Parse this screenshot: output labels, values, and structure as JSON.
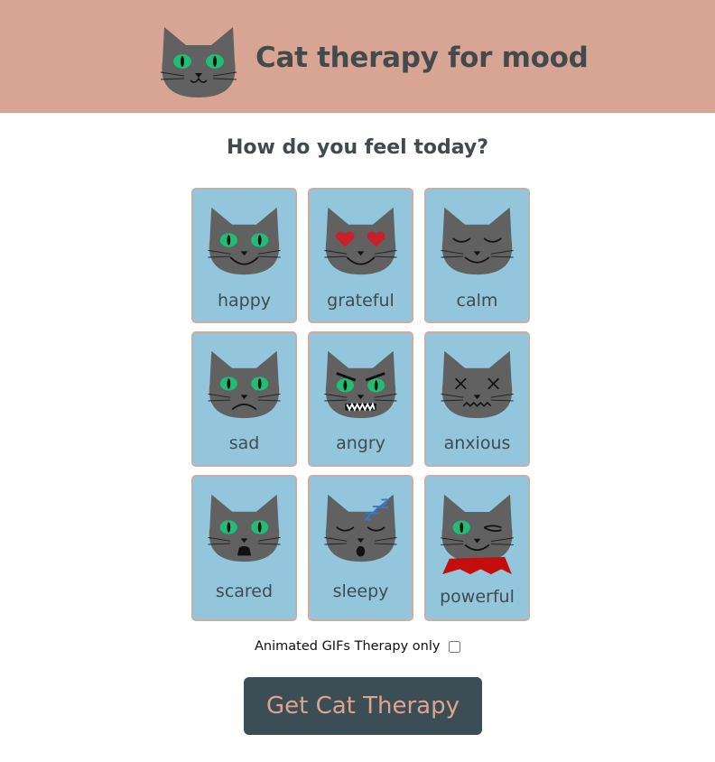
{
  "header": {
    "title": "Cat therapy for mood",
    "logo_icon": "cat-face-icon"
  },
  "prompt": "How do you feel today?",
  "moods": [
    {
      "label": "happy",
      "icon": "cat-happy-icon"
    },
    {
      "label": "grateful",
      "icon": "cat-heart-eyes-icon"
    },
    {
      "label": "calm",
      "icon": "cat-calm-icon"
    },
    {
      "label": "sad",
      "icon": "cat-sad-icon"
    },
    {
      "label": "angry",
      "icon": "cat-angry-icon"
    },
    {
      "label": "anxious",
      "icon": "cat-anxious-icon"
    },
    {
      "label": "scared",
      "icon": "cat-scared-icon"
    },
    {
      "label": "sleepy",
      "icon": "cat-sleepy-icon"
    },
    {
      "label": "powerful",
      "icon": "cat-powerful-cape-icon"
    }
  ],
  "options": {
    "gif_only_label": "Animated GIFs Therapy only",
    "gif_only_checked": false
  },
  "action": {
    "button_label": "Get Cat Therapy"
  },
  "colors": {
    "header_bg": "#d8a594",
    "card_bg": "#93c6dd",
    "card_border": "#c9aea6",
    "cat_fur": "#616161",
    "cat_eye": "#1fbd76",
    "button_bg": "#3b4d55",
    "button_text": "#dea48f",
    "text": "#424a4e"
  }
}
